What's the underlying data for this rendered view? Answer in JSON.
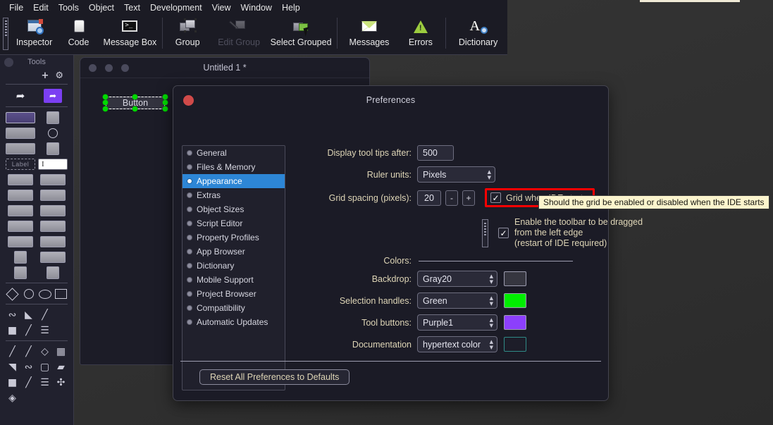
{
  "menubar": {
    "items": [
      "File",
      "Edit",
      "Tools",
      "Object",
      "Text",
      "Development",
      "View",
      "Window",
      "Help"
    ]
  },
  "toolbar": {
    "items": [
      {
        "label": "Inspector",
        "icon": "inspector-icon",
        "disabled": false
      },
      {
        "label": "Code",
        "icon": "code-icon",
        "disabled": false
      },
      {
        "label": "Message Box",
        "icon": "message-box-icon",
        "disabled": false
      },
      {
        "label": "Group",
        "icon": "group-icon",
        "disabled": false
      },
      {
        "label": "Edit Group",
        "icon": "edit-group-icon",
        "disabled": true
      },
      {
        "label": "Select Grouped",
        "icon": "select-grouped-icon",
        "disabled": false
      },
      {
        "label": "Messages",
        "icon": "messages-icon",
        "disabled": false
      },
      {
        "label": "Errors",
        "icon": "errors-icon",
        "disabled": false
      },
      {
        "label": "Dictionary",
        "icon": "dictionary-icon",
        "disabled": false
      }
    ]
  },
  "tools_palette": {
    "title": "Tools",
    "add_label": "+",
    "gear_label": "⚙"
  },
  "document_window": {
    "title": "Untitled 1 *",
    "object_label": "Button"
  },
  "preferences": {
    "title": "Preferences",
    "categories": [
      {
        "label": "General",
        "selected": false
      },
      {
        "label": "Files & Memory",
        "selected": false
      },
      {
        "label": "Appearance",
        "selected": true
      },
      {
        "label": "Extras",
        "selected": false
      },
      {
        "label": "Object Sizes",
        "selected": false
      },
      {
        "label": "Script Editor",
        "selected": false
      },
      {
        "label": "Property Profiles",
        "selected": false
      },
      {
        "label": "App Browser",
        "selected": false
      },
      {
        "label": "Dictionary",
        "selected": false
      },
      {
        "label": "Mobile Support",
        "selected": false
      },
      {
        "label": "Project Browser",
        "selected": false
      },
      {
        "label": "Compatibility",
        "selected": false
      },
      {
        "label": "Automatic Updates",
        "selected": false
      }
    ],
    "tooltip_delay": {
      "label": "Display tool tips after:",
      "value": "500"
    },
    "ruler_units": {
      "label": "Ruler units:",
      "value": "Pixels"
    },
    "grid_spacing": {
      "label": "Grid spacing (pixels):",
      "value": "20",
      "minus_label": "-",
      "plus_label": "+"
    },
    "grid_when_ide_starts": {
      "label": "Grid when IDE starts",
      "checked": true,
      "highlight_color": "#ff0000"
    },
    "tooltip": {
      "text": "Should the grid be enabled or disabled when the IDE starts",
      "background": "#fbf4cd"
    },
    "toolbar_drag": {
      "checked": true,
      "line1": "Enable the toolbar to be dragged",
      "line2": "from the left edge",
      "line3": "(restart of IDE required)"
    },
    "colors_label": "Colors:",
    "color_rows": [
      {
        "label": "Backdrop:",
        "value": "Gray20",
        "swatch": "#363640"
      },
      {
        "label": "Selection handles:",
        "value": "Green",
        "swatch": "#00ee00"
      },
      {
        "label": "Tool buttons:",
        "value": "Purple1",
        "swatch": "#8c3ffc"
      },
      {
        "label": "Documentation",
        "value": "hypertext color",
        "swatch": "#1d1d29"
      }
    ],
    "reset_button": "Reset All Preferences to Defaults"
  }
}
